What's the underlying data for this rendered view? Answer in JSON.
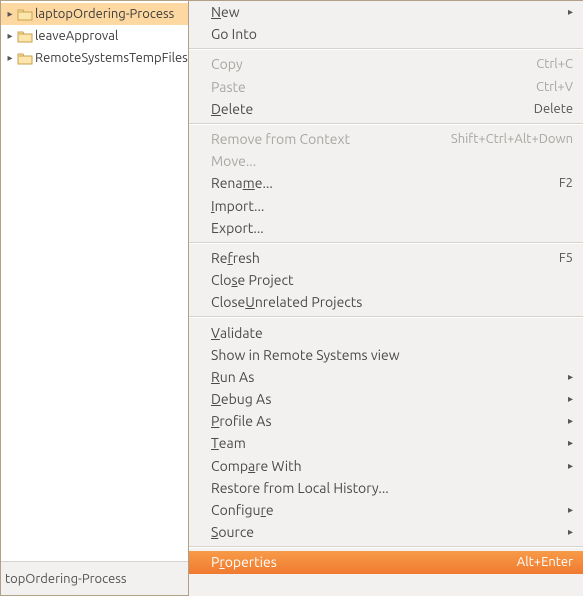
{
  "tree": {
    "items": [
      {
        "label": "laptopOrdering-Process",
        "selected": true,
        "expandable": true
      },
      {
        "label": "leaveApproval",
        "selected": false,
        "expandable": true
      },
      {
        "label": "RemoteSystemsTempFiles",
        "selected": false,
        "expandable": true
      }
    ]
  },
  "status_bar": {
    "text": "topOrdering-Process"
  },
  "menu": {
    "groups": [
      [
        {
          "label": "New",
          "u": 0,
          "submenu": true
        },
        {
          "label": "Go Into",
          "u": -1
        }
      ],
      [
        {
          "label": "Copy",
          "u": -1,
          "shortcut": "Ctrl+C",
          "disabled": true
        },
        {
          "label": "Paste",
          "u": -1,
          "shortcut": "Ctrl+V",
          "disabled": true
        },
        {
          "label": "Delete",
          "u": 0,
          "shortcut": "Delete"
        }
      ],
      [
        {
          "label": "Remove from Context",
          "u": -1,
          "shortcut": "Shift+Ctrl+Alt+Down",
          "disabled": true
        },
        {
          "label": "Move...",
          "u": -1,
          "disabled": true
        },
        {
          "label": "Rename...",
          "u": 4,
          "shortcut": "F2"
        },
        {
          "label": "Import...",
          "u": 0
        },
        {
          "label": "Export...",
          "u": -1
        }
      ],
      [
        {
          "label": "Refresh",
          "u": 2,
          "shortcut": "F5"
        },
        {
          "label": "Close Project",
          "u": 3
        },
        {
          "label": "Close Unrelated Projects",
          "u": 6
        }
      ],
      [
        {
          "label": "Validate",
          "u": 0
        },
        {
          "label": "Show in Remote Systems view",
          "u": -1
        },
        {
          "label": "Run As",
          "u": 0,
          "submenu": true
        },
        {
          "label": "Debug As",
          "u": 0,
          "submenu": true
        },
        {
          "label": "Profile As",
          "u": 0,
          "submenu": true
        },
        {
          "label": "Team",
          "u": 0,
          "submenu": true
        },
        {
          "label": "Compare With",
          "u": 4,
          "submenu": true
        },
        {
          "label": "Restore from Local History...",
          "u": -1
        },
        {
          "label": "Configure",
          "u": 7,
          "submenu": true
        },
        {
          "label": "Source",
          "u": 0,
          "submenu": true
        }
      ],
      [
        {
          "label": "Properties",
          "u": 1,
          "shortcut": "Alt+Enter",
          "highlight": true
        }
      ]
    ]
  }
}
